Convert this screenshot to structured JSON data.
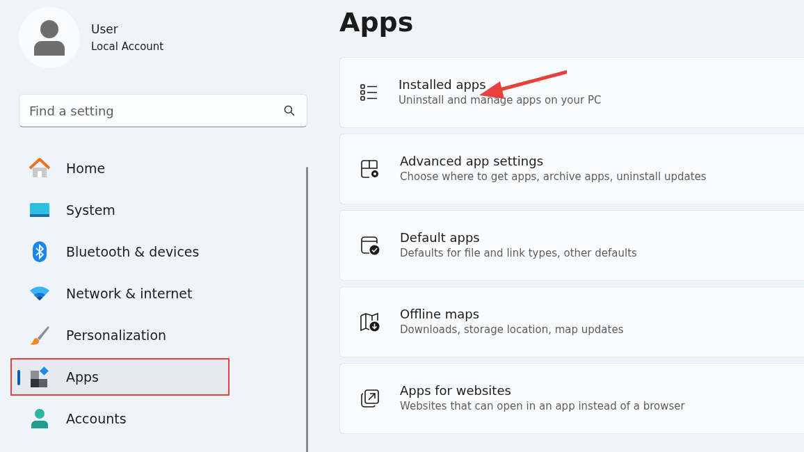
{
  "account": {
    "name": "User",
    "type": "Local Account"
  },
  "search": {
    "placeholder": "Find a setting"
  },
  "nav": [
    {
      "label": "Home",
      "selected": false,
      "annotated": false
    },
    {
      "label": "System",
      "selected": false,
      "annotated": false
    },
    {
      "label": "Bluetooth & devices",
      "selected": false,
      "annotated": false
    },
    {
      "label": "Network & internet",
      "selected": false,
      "annotated": false
    },
    {
      "label": "Personalization",
      "selected": false,
      "annotated": false
    },
    {
      "label": "Apps",
      "selected": true,
      "annotated": true
    },
    {
      "label": "Accounts",
      "selected": false,
      "annotated": false
    }
  ],
  "page_title": "Apps",
  "cards": [
    {
      "title": "Installed apps",
      "description": "Uninstall and manage apps on your PC",
      "arrow": true
    },
    {
      "title": "Advanced app settings",
      "description": "Choose where to get apps, archive apps, uninstall updates",
      "arrow": false
    },
    {
      "title": "Default apps",
      "description": "Defaults for file and link types, other defaults",
      "arrow": false
    },
    {
      "title": "Offline maps",
      "description": "Downloads, storage location, map updates",
      "arrow": false
    },
    {
      "title": "Apps for websites",
      "description": "Websites that can open in an app instead of a browser",
      "arrow": false
    }
  ]
}
